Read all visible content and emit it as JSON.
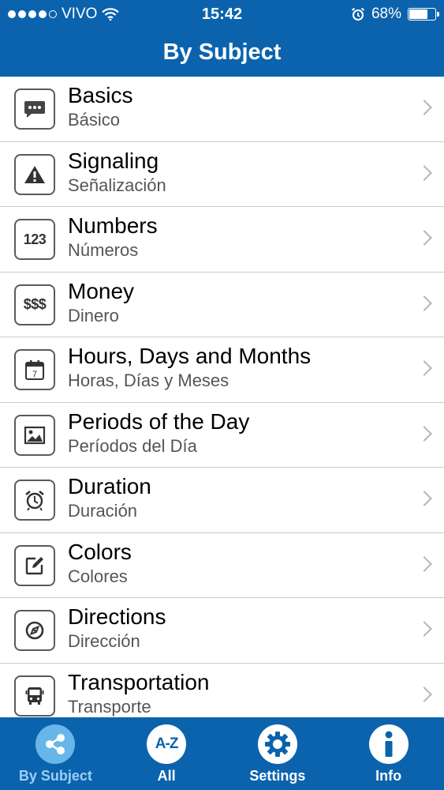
{
  "status": {
    "carrier": "VIVO",
    "time": "15:42",
    "battery": "68%",
    "battery_level": 0.68
  },
  "header": {
    "title": "By Subject"
  },
  "items": [
    {
      "title": "Basics",
      "subtitle": "Básico",
      "icon": "chat-bubble-icon"
    },
    {
      "title": "Signaling",
      "subtitle": "Señalización",
      "icon": "warning-icon"
    },
    {
      "title": "Numbers",
      "subtitle": "Números",
      "icon": "numbers-icon",
      "icon_text": "123"
    },
    {
      "title": "Money",
      "subtitle": "Dinero",
      "icon": "money-icon",
      "icon_text": "$$$"
    },
    {
      "title": "Hours, Days and Months",
      "subtitle": "Horas, Días y Meses",
      "icon": "calendar-icon",
      "icon_text": "7"
    },
    {
      "title": "Periods of the Day",
      "subtitle": "Períodos del Día",
      "icon": "picture-icon"
    },
    {
      "title": "Duration",
      "subtitle": "Duración",
      "icon": "alarm-clock-icon"
    },
    {
      "title": "Colors",
      "subtitle": "Colores",
      "icon": "edit-icon"
    },
    {
      "title": "Directions",
      "subtitle": "Dirección",
      "icon": "compass-icon"
    },
    {
      "title": "Transportation",
      "subtitle": "Transporte",
      "icon": "bus-icon"
    }
  ],
  "tabs": [
    {
      "label": "By Subject",
      "icon": "share-icon",
      "active": true
    },
    {
      "label": "All",
      "icon": "a-z-icon",
      "icon_text": "A-Z",
      "active": false
    },
    {
      "label": "Settings",
      "icon": "gear-icon",
      "active": false
    },
    {
      "label": "Info",
      "icon": "info-icon",
      "active": false
    }
  ],
  "colors": {
    "brand": "#0b63ad",
    "active_tab": "#66b6ea"
  }
}
